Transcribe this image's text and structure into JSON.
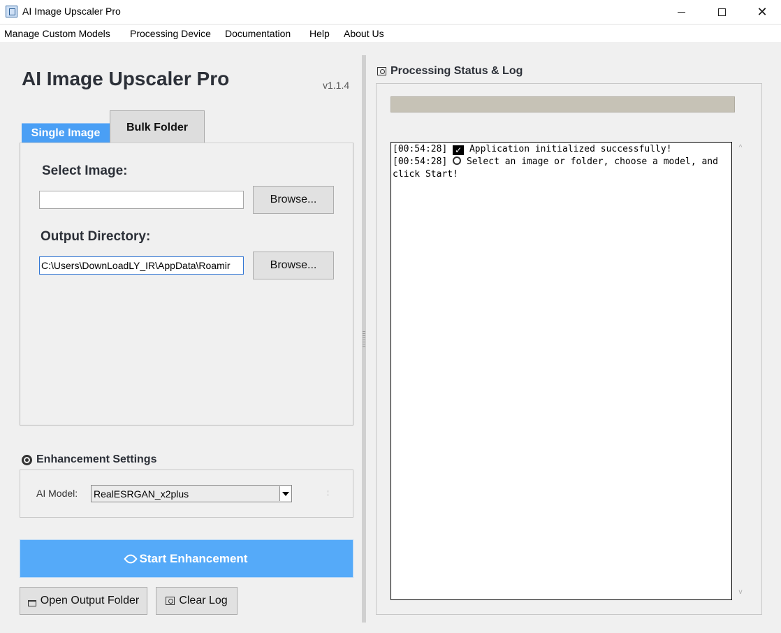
{
  "window": {
    "title": "AI Image Upscaler Pro",
    "minimize_glyph": "",
    "close_glyph": "✕"
  },
  "menu": [
    "Manage Custom Models",
    "Processing Device",
    "Documentation",
    "Help",
    "About Us"
  ],
  "header": {
    "title": "AI Image Upscaler Pro",
    "version": "v1.1.4"
  },
  "tabs": [
    {
      "label": "Single Image",
      "active": true
    },
    {
      "label": "Bulk Folder",
      "active": false
    }
  ],
  "single_image": {
    "select_label": "Select Image:",
    "select_value": "",
    "output_label": "Output Directory:",
    "output_value": "C:\\Users\\DownLoadLY_IR\\AppData\\Roamir",
    "browse_label": "Browse..."
  },
  "settings": {
    "heading": "Enhancement Settings",
    "heading_icon": "gear-icon",
    "model_label": "AI Model:",
    "model_value": "RealESRGAN_x2plus"
  },
  "actions": {
    "start_label": "Start Enhancement",
    "open_folder_label": "Open Output Folder",
    "clear_log_label": "Clear Log",
    "start_color": "#55aaf9"
  },
  "status": {
    "heading": "Processing Status & Log",
    "progress": 0,
    "log": [
      {
        "time": "[00:54:28]",
        "icon": "check-icon",
        "text": "Application initialized successfully!"
      },
      {
        "time": "[00:54:28]",
        "icon": "target-icon",
        "text": "Select an image or folder, choose a model, and click Start!"
      }
    ]
  },
  "colors": {
    "accent": "#4a9ff5",
    "title_text": "#2c3038"
  }
}
